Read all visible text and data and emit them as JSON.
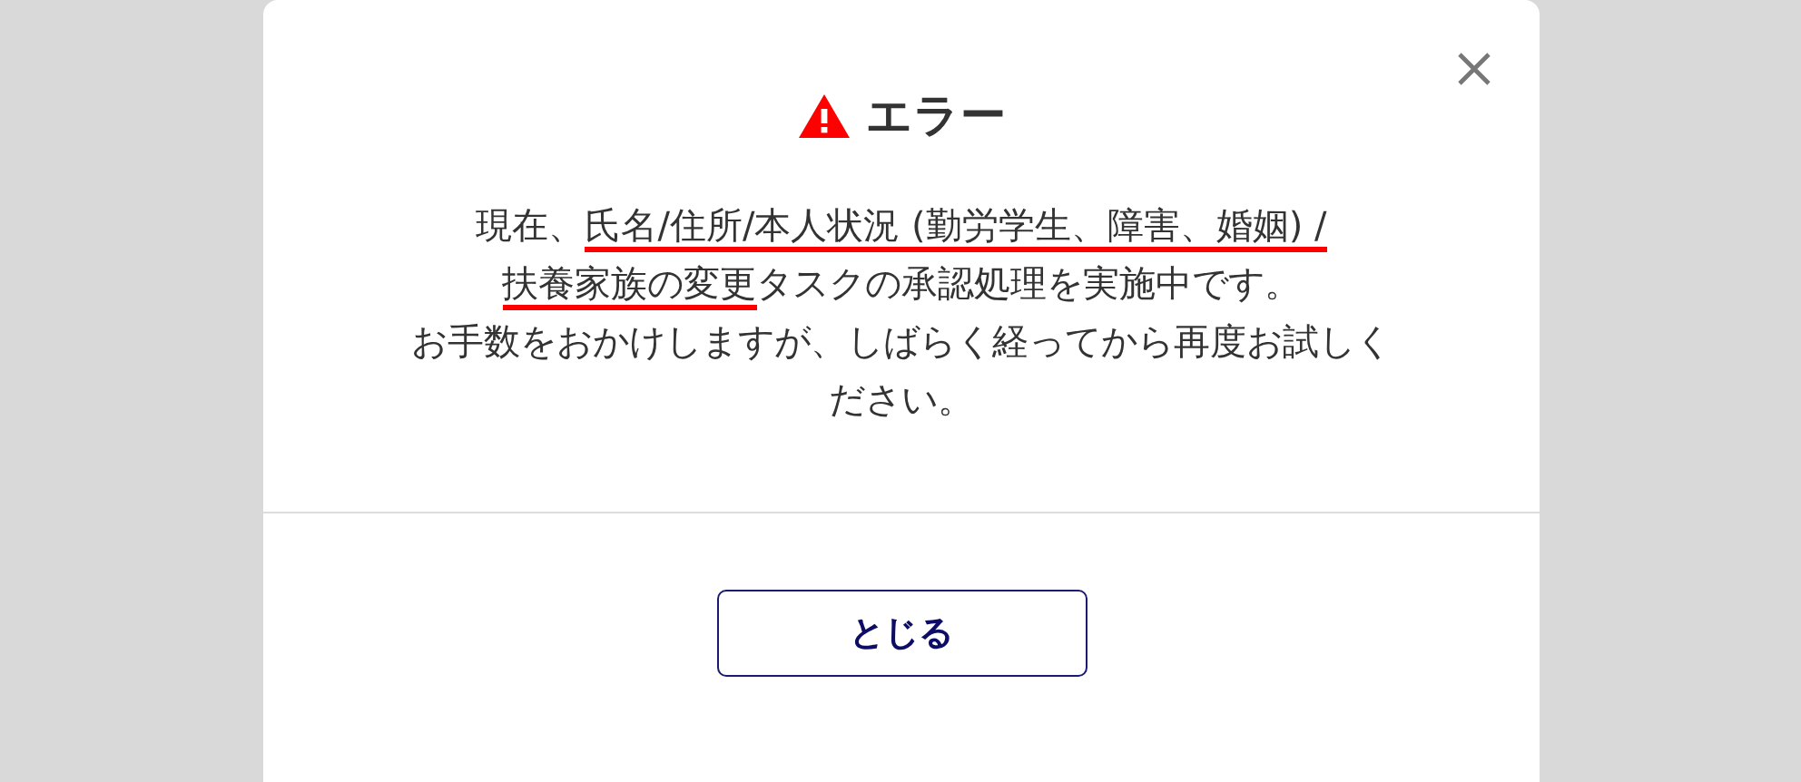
{
  "dialog": {
    "title": "エラー",
    "message_lines": [
      [
        {
          "text": "現在、",
          "underlined": false
        },
        {
          "text": "氏名/住所/本人状況 (勤労学生、障害、婚姻) /",
          "underlined": true
        }
      ],
      [
        {
          "text": "扶養家族の変更",
          "underlined": true
        },
        {
          "text": "タスクの承認処理を実施中です。",
          "underlined": false
        }
      ],
      [
        {
          "text": "お手数をおかけしますが、しばらく経ってから再度お試しく",
          "underlined": false
        }
      ],
      [
        {
          "text": "ださい。",
          "underlined": false
        }
      ]
    ],
    "button": "とじる"
  }
}
